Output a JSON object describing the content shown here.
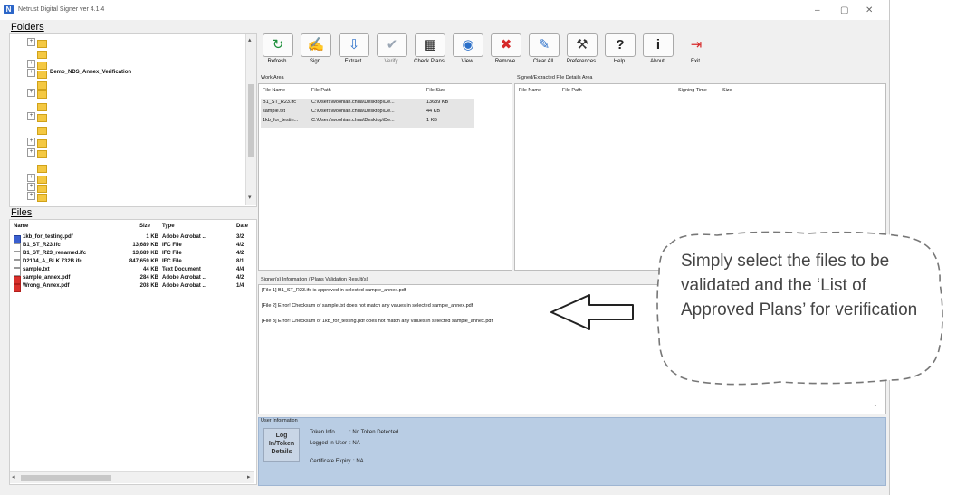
{
  "window": {
    "title": "Netrust Digital Signer ver 4.1.4",
    "controls": {
      "minimize": "–",
      "maximize": "▢",
      "close": "✕"
    }
  },
  "folders": {
    "header": "Folders",
    "selected_folder": "Demo_NDS_Annex_Verification"
  },
  "files": {
    "header": "Files",
    "columns": [
      "Name",
      "Size",
      "Type",
      "Date"
    ],
    "rows": [
      {
        "name": "1kb_for_testing.pdf",
        "size": "1 KB",
        "type": "Adobe Acrobat ...",
        "date": "3/2"
      },
      {
        "name": "B1_ST_R23.ifc",
        "size": "13,689 KB",
        "type": "IFC File",
        "date": "4/2"
      },
      {
        "name": "B1_ST_R23_renamed.ifc",
        "size": "13,689 KB",
        "type": "IFC File",
        "date": "4/2"
      },
      {
        "name": "D2104_A_BLK 732B.ifc",
        "size": "847,659 KB",
        "type": "IFC File",
        "date": "8/1"
      },
      {
        "name": "sample.txt",
        "size": "44 KB",
        "type": "Text Document",
        "date": "4/4"
      },
      {
        "name": "sample_annex.pdf",
        "size": "284 KB",
        "type": "Adobe Acrobat ...",
        "date": "4/2"
      },
      {
        "name": "Wrong_Annex.pdf",
        "size": "208 KB",
        "type": "Adobe Acrobat ...",
        "date": "1/4"
      }
    ]
  },
  "toolbar": {
    "buttons": [
      {
        "label": "Refresh",
        "icon": "↻"
      },
      {
        "label": "Sign",
        "icon": "✍"
      },
      {
        "label": "Extract",
        "icon": "⇩"
      },
      {
        "label": "Verify",
        "icon": "✔"
      },
      {
        "label": "Check Plans",
        "icon": "▦"
      },
      {
        "label": "View",
        "icon": "◉"
      },
      {
        "label": "Remove",
        "icon": "✖"
      },
      {
        "label": "Clear All",
        "icon": "✎"
      },
      {
        "label": "Preferences",
        "icon": "⚒"
      },
      {
        "label": "Help",
        "icon": "?"
      },
      {
        "label": "About",
        "icon": "i"
      },
      {
        "label": "Exit",
        "icon": "⇥"
      }
    ]
  },
  "work_area": {
    "label": "Work Area",
    "columns": [
      "File Name",
      "File Path",
      "File Size"
    ],
    "rows": [
      {
        "name": "B1_ST_R23.ifc",
        "path": "C:\\Users\\woohian.chua\\Desktop\\De...",
        "size": "13689 KB"
      },
      {
        "name": "sample.txt",
        "path": "C:\\Users\\woohian.chua\\Desktop\\De...",
        "size": "44 KB"
      },
      {
        "name": "1kb_for_testin...",
        "path": "C:\\Users\\woohian.chua\\Desktop\\De...",
        "size": "1 KB"
      }
    ]
  },
  "signed_area": {
    "label": "Signed/Extracted File Details Area",
    "columns": [
      "File Name",
      "File Path",
      "Signing Time",
      "Size"
    ]
  },
  "results": {
    "label": "Signer(s) Information / Plans Validation Result(s)",
    "lines": [
      "[File 1] B1_ST_R23.ifc is approved in selected sample_annex.pdf",
      "[File 2] Error! Checksum of sample.txt does not match any values in selected sample_annex.pdf",
      "[File 3] Error! Checksum of 1kb_for_testing.pdf does not match any values in selected sample_annex.pdf"
    ]
  },
  "user_info": {
    "label": "User Information",
    "log_button_lines": [
      "Log",
      "In/Token",
      "Details"
    ],
    "token_label": "Token Info",
    "token_value": ": No Token Detected.",
    "user_label": "Logged In User",
    "user_value": ": NA",
    "cert_label": "Certificate Expiry",
    "cert_value": ": NA"
  },
  "callout": {
    "text": "Simply select the files to be validated and the ‘List of Approved Plans’ for verification"
  },
  "colors": {
    "user_info_bg": "#b9cde4",
    "selected_row_bg": "#e5e5e5"
  }
}
